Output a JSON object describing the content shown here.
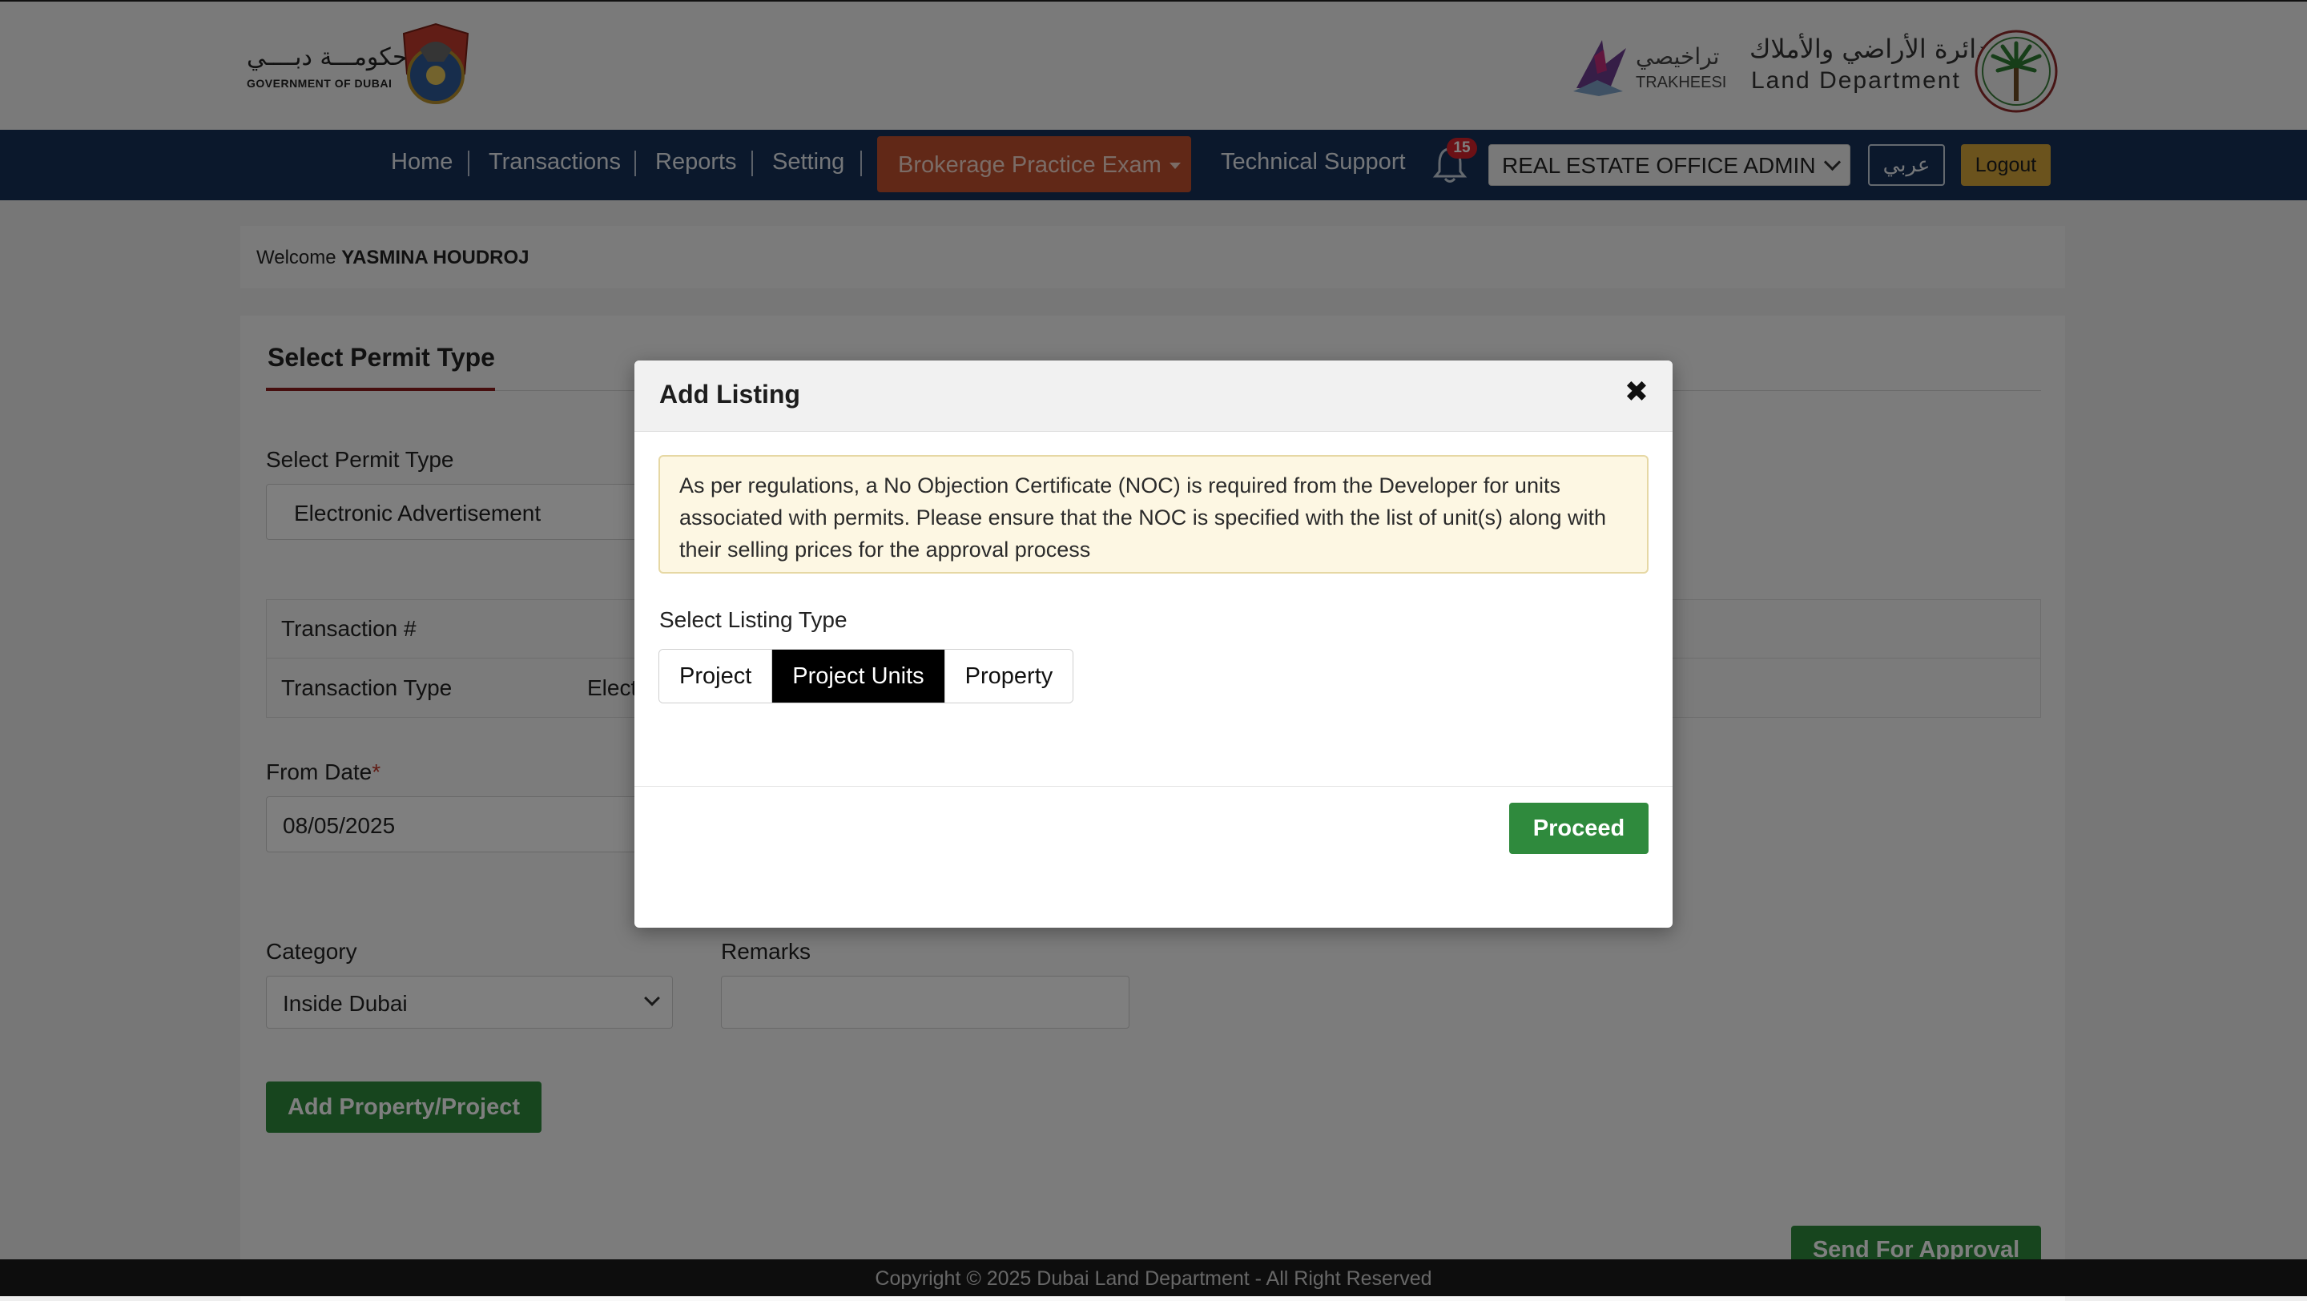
{
  "header": {
    "gov_logo_ar": "حكومـــة دبــــي",
    "gov_logo_en": "GOVERNMENT OF DUBAI",
    "trakheesi_ar": "تراخيصي",
    "trakheesi_en": "TRAKHEESI",
    "dld_ar": "دائرة الأراضي والأملاك",
    "dld_en": "Land Department"
  },
  "nav": {
    "items": [
      {
        "label": "Home"
      },
      {
        "label": "Transactions"
      },
      {
        "label": "Reports"
      },
      {
        "label": "Setting"
      }
    ],
    "exam_label": "Brokerage Practice Exam",
    "support_label": "Technical Support",
    "notification_count": "15",
    "role": "REAL ESTATE OFFICE ADMIN",
    "arabic_label": "عربي",
    "logout_label": "Logout"
  },
  "page": {
    "welcome_prefix": "Welcome",
    "user_name": "YASMINA HOUDROJ",
    "tab_title": "Select Permit Type",
    "permit_type_label": "Select Permit Type",
    "permit_type_value": "Electronic Advertisement",
    "transaction_no_label": "Transaction #",
    "transaction_type_label": "Transaction Type",
    "transaction_type_value": "Elect",
    "from_date_label": "From Date",
    "required_mark": "*",
    "from_date_value": "08/05/2025",
    "category_label": "Category",
    "category_value": "Inside Dubai",
    "remarks_label": "Remarks",
    "add_property_label": "Add Property/Project",
    "send_approval_label": "Send For Approval"
  },
  "footer": {
    "copyright": "Copyright © 2025 Dubai Land Department - All Right Reserved"
  },
  "modal": {
    "title": "Add Listing",
    "close_symbol": "✖",
    "notice": "As per regulations, a No Objection Certificate (NOC) is required from the Developer for units associated with permits. Please ensure that the NOC is specified with the list of unit(s) along with their selling prices for the approval process",
    "listing_type_label": "Select Listing Type",
    "listing_types": [
      {
        "label": "Project",
        "active": false
      },
      {
        "label": "Project Units",
        "active": true
      },
      {
        "label": "Property",
        "active": false
      }
    ],
    "proceed_label": "Proceed"
  },
  "colors": {
    "nav_bg": "#173158",
    "exam_btn": "#c3502e",
    "logout_btn": "#d6a73a",
    "proceed_btn": "#2f8a3d",
    "active_segment": "#000000"
  }
}
